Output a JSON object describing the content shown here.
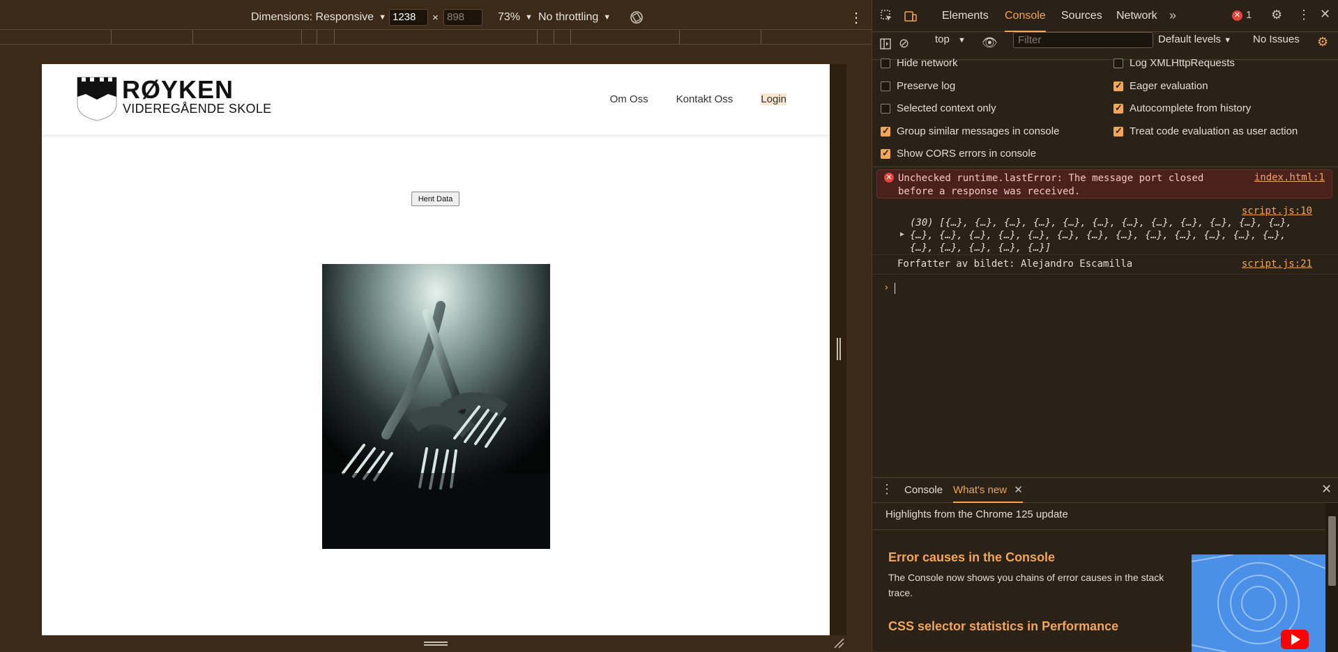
{
  "emulation": {
    "dimensions_label": "Dimensions: Responsive",
    "width_value": "1238",
    "height_value": "898",
    "zoom": "73%",
    "throttling": "No throttling"
  },
  "site": {
    "logo_title": "RØYKEN",
    "logo_subtitle": "VIDEREGÅENDE SKOLE",
    "nav": [
      "Om Oss",
      "Kontakt Oss",
      "Login"
    ],
    "button_label": "Hent Data"
  },
  "devtools": {
    "tabs": [
      "Elements",
      "Console",
      "Sources",
      "Network"
    ],
    "active_tab": "Console",
    "error_count": "1",
    "context": "top",
    "filter_placeholder": "Filter",
    "levels": "Default levels",
    "issues": "No Issues",
    "settings": [
      {
        "label": "Hide network",
        "checked": false
      },
      {
        "label": "Log XMLHttpRequests",
        "checked": false
      },
      {
        "label": "Preserve log",
        "checked": false
      },
      {
        "label": "Eager evaluation",
        "checked": true
      },
      {
        "label": "Selected context only",
        "checked": false
      },
      {
        "label": "Autocomplete from history",
        "checked": true
      },
      {
        "label": "Group similar messages in console",
        "checked": true
      },
      {
        "label": "Treat code evaluation as user action",
        "checked": true
      },
      {
        "label": "Show CORS errors in console",
        "checked": true
      }
    ],
    "console": {
      "error_text": "Unchecked runtime.lastError: The message port closed before a response was received.",
      "error_source": "index.html:1",
      "array_source": "script.js:10",
      "array_text": "(30) [{…}, {…}, {…}, {…}, {…}, {…}, {…}, {…}, {…}, {…}, {…}, {…}, {…}, {…}, {…}, {…}, {…}, {…}, {…}, {…}, {…}, {…}, {…}, {…}, {…}, {…}, {…}, {…}, {…}, {…}]",
      "message_text": "Forfatter av bildet: Alejandro Escamilla",
      "message_source": "script.js:21"
    },
    "drawer": {
      "tabs": [
        "Console",
        "What's new"
      ],
      "active_tab": "What's new",
      "highlights": "Highlights from the Chrome 125 update",
      "feature1_title": "Error causes in the Console",
      "feature1_desc": "The Console now shows you chains of error causes in the stack trace.",
      "feature2_title": "CSS selector statistics in Performance"
    }
  },
  "colors": {
    "accent": "#f2a65a",
    "panel_bg": "#2a2117",
    "outer_bg": "#3a2a17"
  }
}
